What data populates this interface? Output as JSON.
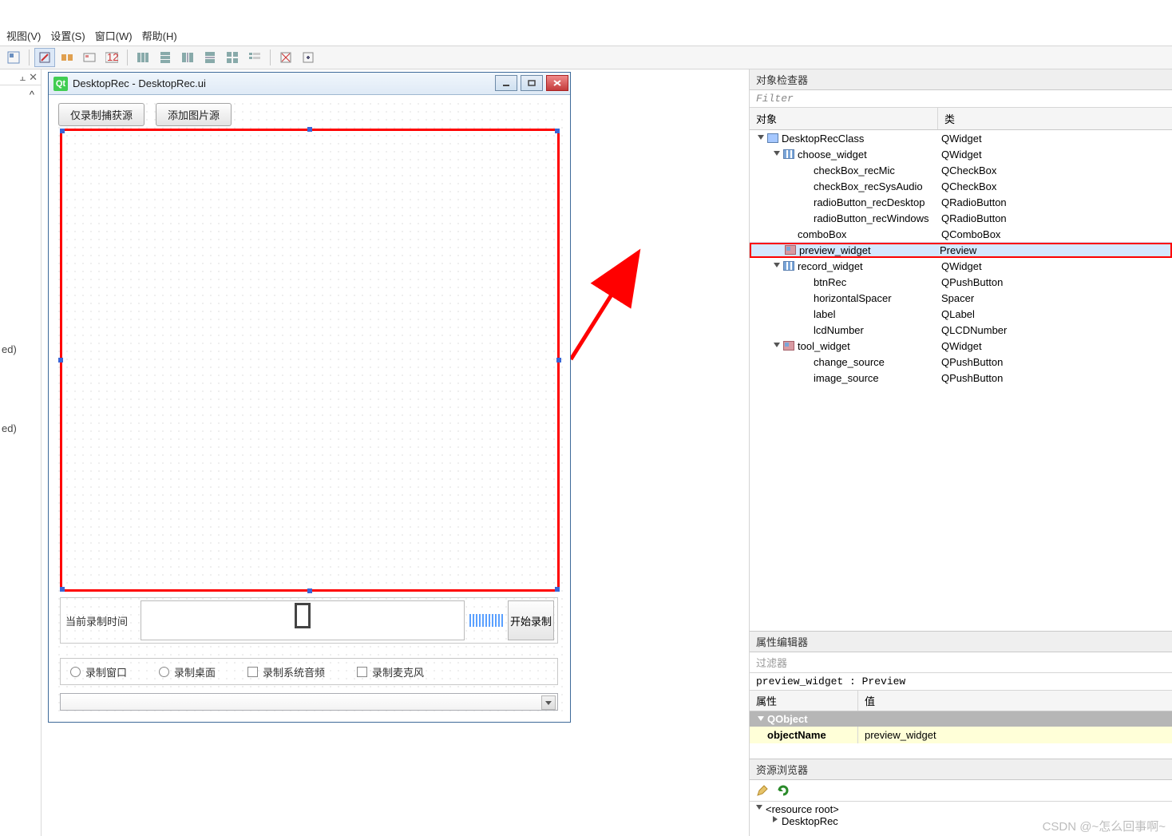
{
  "menubar": {
    "view": "视图(V)",
    "settings": "设置(S)",
    "window": "窗口(W)",
    "help": "帮助(H)"
  },
  "leftDock": {
    "pin": "⫠",
    "close": "✕",
    "row1": "ed)",
    "row2": "ed)",
    "top": "^"
  },
  "designerWindow": {
    "title": "DesktopRec - DesktopRec.ui",
    "buttons": {
      "changeSource": "仅录制捕获源",
      "imageSource": "添加图片源"
    },
    "recordBar": {
      "label": "当前录制时间",
      "lcd": "0",
      "start": "开始录制"
    },
    "options": {
      "recWindow": "录制窗口",
      "recDesktop": "录制桌面",
      "recSysAudio": "录制系统音频",
      "recMic": "录制麦克风"
    }
  },
  "objectInspector": {
    "title": "对象检查器",
    "filterPlaceholder": "Filter",
    "headers": {
      "object": "对象",
      "class": "类"
    },
    "rows": [
      {
        "indent": 0,
        "expand": "open",
        "icon": "w",
        "name": "DesktopRecClass",
        "cls": "QWidget"
      },
      {
        "indent": 1,
        "expand": "open",
        "icon": "lay",
        "name": "choose_widget",
        "cls": "QWidget"
      },
      {
        "indent": 2,
        "expand": "",
        "icon": "",
        "name": "checkBox_recMic",
        "cls": "QCheckBox"
      },
      {
        "indent": 2,
        "expand": "",
        "icon": "",
        "name": "checkBox_recSysAudio",
        "cls": "QCheckBox"
      },
      {
        "indent": 2,
        "expandємної": "",
        "icon": "",
        "name": "radioButton_recDesktop",
        "cls": "QRadioButton"
      },
      {
        "indent": 2,
        "expand": "",
        "icon": "",
        "name": "radioButton_recWindows",
        "cls": "QRadioButton"
      },
      {
        "indent": 1,
        "expand": "",
        "icon": "",
        "name": "comboBox",
        "cls": "QComboBox"
      },
      {
        "indent": 1,
        "expand": "",
        "icon": "custom",
        "name": "preview_widget",
        "cls": "Preview",
        "highlight": true,
        "redbox": true
      },
      {
        "indent": 1,
        "expand": "open",
        "icon": "lay",
        "name": "record_widget",
        "cls": "QWidget"
      },
      {
        "indent": 2,
        "expand": "",
        "icon": "",
        "name": "btnRec",
        "cls": "QPushButton"
      },
      {
        "indent": 2,
        "expand": "",
        "icon": "",
        "name": "horizontalSpacer",
        "cls": "Spacer"
      },
      {
        "indent": 2,
        "expand": "",
        "icon": "",
        "name": "label",
        "cls": "QLabel"
      },
      {
        "indent": 2,
        "expand": "",
        "icon": "",
        "name": "lcdNumber",
        "cls": "QLCDNumber"
      },
      {
        "indent": 1,
        "expand": "open",
        "icon": "custom",
        "name": "tool_widget",
        "cls": "QWidget"
      },
      {
        "indent": 2,
        "expand": "",
        "icon": "",
        "name": "change_source",
        "cls": "QPushButton"
      },
      {
        "indent": 2,
        "expand": "",
        "icon": "",
        "name": "image_source",
        "cls": "QPushButton"
      }
    ]
  },
  "propertyEditor": {
    "title": "属性编辑器",
    "filterPlaceholder": "过滤器",
    "objectLine": "preview_widget : Preview",
    "headers": {
      "prop": "属性",
      "value": "值"
    },
    "section": "QObject",
    "row": {
      "name": "objectName",
      "value": "preview_widget"
    }
  },
  "resourceBrowser": {
    "title": "资源浏览器",
    "root": "<resource root>",
    "child": "DesktopRec"
  },
  "watermark": "CSDN @~怎么回事啊~"
}
